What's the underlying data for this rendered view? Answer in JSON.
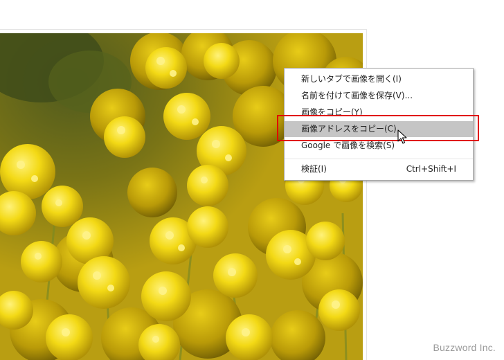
{
  "image": {
    "description_icon": "rapeseed-flower-photo-icon"
  },
  "context_menu": {
    "items": [
      {
        "label": "新しいタブで画像を開く(I)",
        "shortcut": ""
      },
      {
        "label": "名前を付けて画像を保存(V)...",
        "shortcut": ""
      },
      {
        "label": "画像をコピー(Y)",
        "shortcut": ""
      },
      {
        "label": "画像アドレスをコピー(C)",
        "shortcut": "",
        "highlighted": true
      },
      {
        "label": "Google で画像を検索(S)",
        "shortcut": ""
      },
      {
        "label": "検証(I)",
        "shortcut": "Ctrl+Shift+I"
      }
    ]
  },
  "highlight_color": "#e00000",
  "watermark": "Buzzword Inc."
}
